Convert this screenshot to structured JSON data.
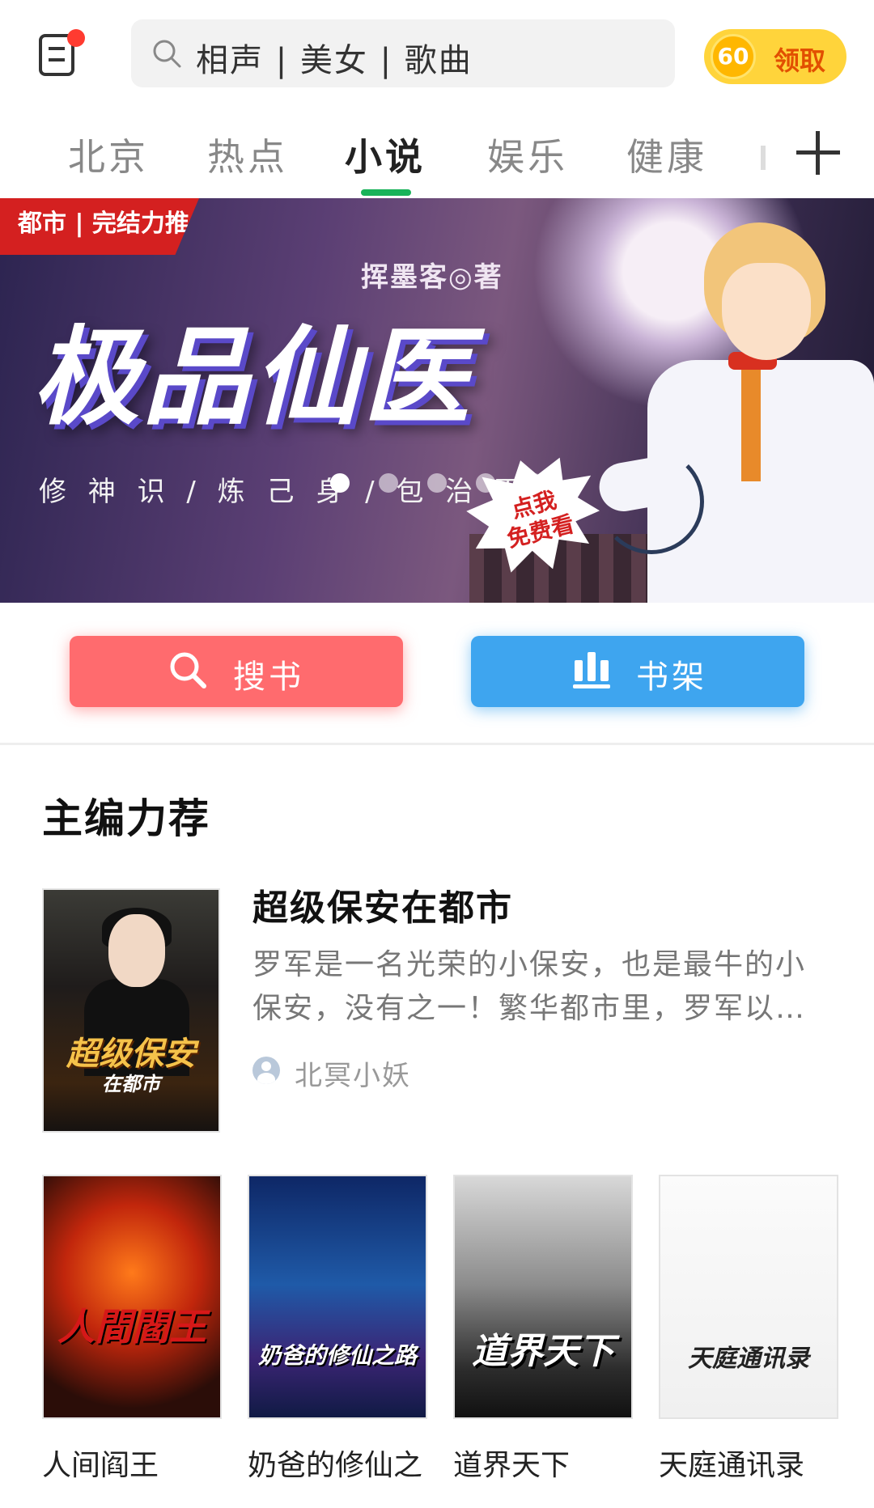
{
  "header": {
    "search_placeholder": "相声 | 美女 | 歌曲",
    "coin_value": "60",
    "coin_label": "领取"
  },
  "tabs": [
    {
      "label": "北京",
      "active": false
    },
    {
      "label": "热点",
      "active": false
    },
    {
      "label": "小说",
      "active": true
    },
    {
      "label": "娱乐",
      "active": false
    },
    {
      "label": "健康",
      "active": false
    }
  ],
  "banner": {
    "tag": "都市 | 完结力推",
    "author": "挥墨客◎著",
    "title": "极品仙医",
    "subtitle": "修 神 识 / 炼 己 身 / 包 治 百 病",
    "cta_line1": "点我",
    "cta_line2": "免费看",
    "slide_count": 5,
    "active_slide": 1
  },
  "actions": {
    "search_label": "搜书",
    "shelf_label": "书架"
  },
  "section": {
    "title": "主编力荐",
    "featured": {
      "title": "超级保安在都市",
      "cover_text": "超级保安",
      "cover_subtext": "在都市",
      "description": "罗军是一名光荣的小保安，也是最牛的小保安，没有之一！繁华都市里，罗军以…",
      "author": "北冥小妖"
    },
    "books": [
      {
        "title": "人间阎王",
        "cover_text": "人間閻王"
      },
      {
        "title": "奶爸的修仙之",
        "cover_text": "奶爸的修仙之路"
      },
      {
        "title": "道界天下",
        "cover_text": "道界天下"
      },
      {
        "title": "天庭通讯录",
        "cover_text": "天庭通讯录"
      }
    ]
  },
  "colors": {
    "accent_green": "#19b35a",
    "search_button": "#ff6b6e",
    "shelf_button": "#3ea5ef",
    "coin_bg": "#ffd43b"
  }
}
